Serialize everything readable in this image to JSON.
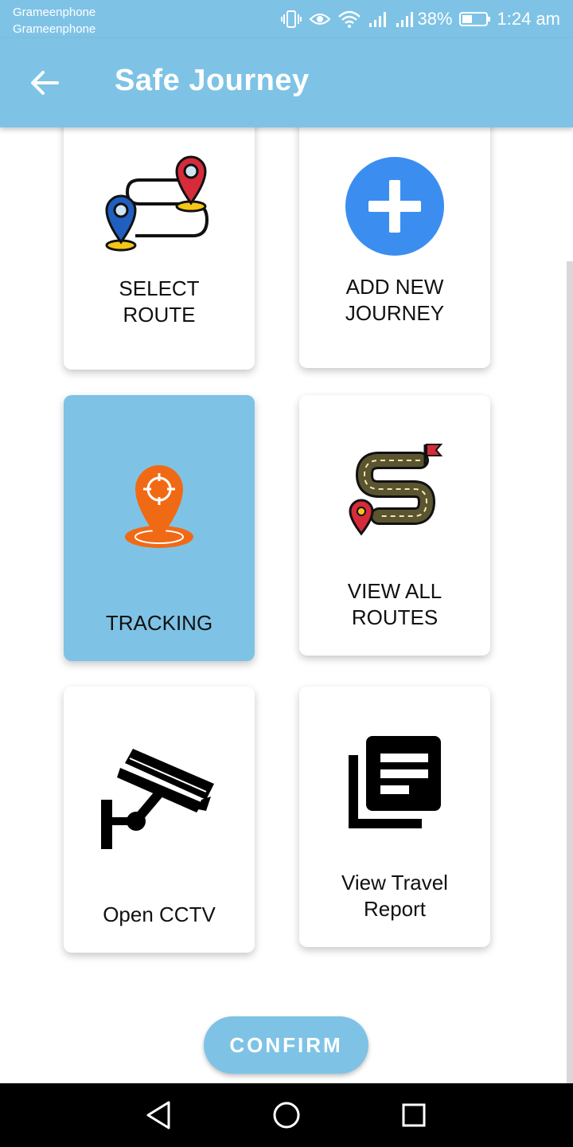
{
  "status_bar": {
    "carrier_1": "Grameenphone",
    "carrier_2": "Grameenphone",
    "battery": "38%",
    "time": "1:24 am"
  },
  "app_bar": {
    "title": "Safe Journey"
  },
  "cards": {
    "select_route": {
      "line1": "SELECT",
      "line2": "ROUTE",
      "icon": "route-pins-icon"
    },
    "add_new_journey": {
      "line1": "ADD NEW",
      "line2": "JOURNEY",
      "icon": "plus-circle-icon"
    },
    "tracking": {
      "line1": "TRACKING",
      "icon": "location-pin-icon",
      "selected": true
    },
    "view_all_routes": {
      "line1": "VIEW ALL",
      "line2": "ROUTES",
      "icon": "road-flag-icon"
    },
    "open_cctv": {
      "line1": "Open CCTV",
      "icon": "cctv-camera-icon"
    },
    "view_travel_report": {
      "line1": "View Travel",
      "line2": "Report",
      "icon": "report-stack-icon"
    }
  },
  "confirm_label": "CONFIRM",
  "colors": {
    "primary": "#7ec3e6",
    "add_circle": "#3b8ef0",
    "tracking_pin": "#f06a16"
  }
}
